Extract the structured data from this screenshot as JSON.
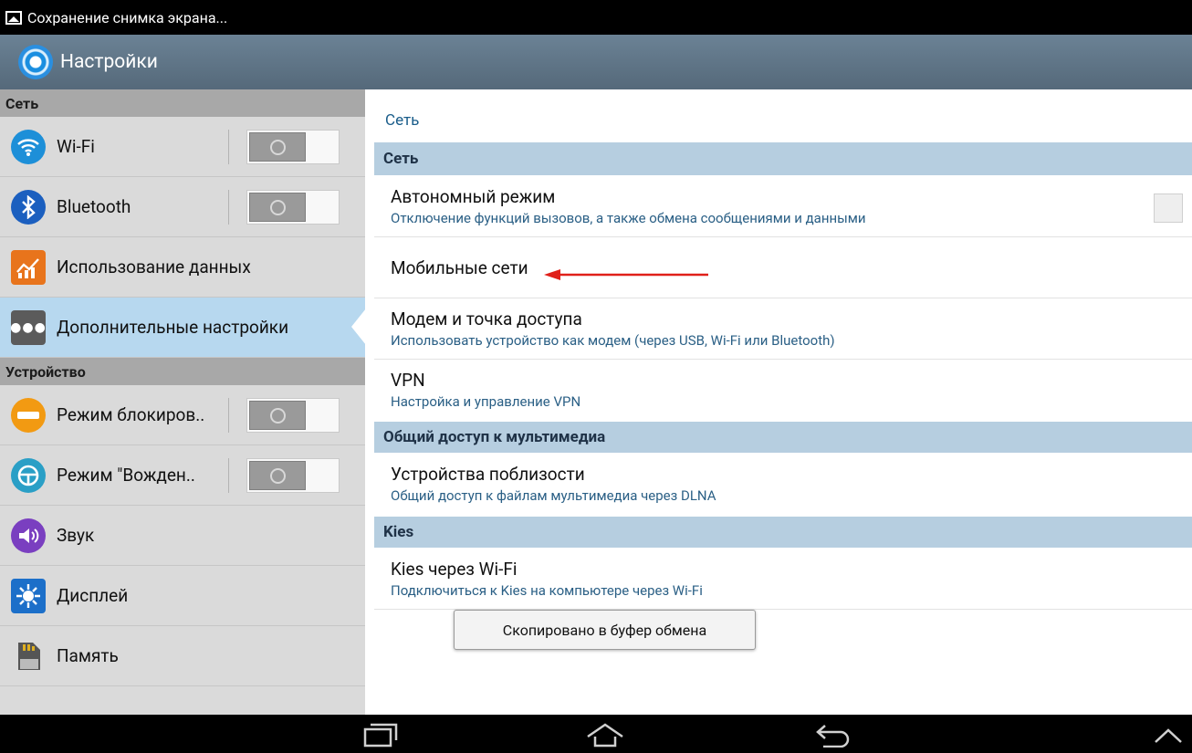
{
  "status_bar": {
    "notification": "Сохранение снимка экрана..."
  },
  "action_bar": {
    "title": "Настройки"
  },
  "left_pane": {
    "sections": [
      {
        "header": "Сеть"
      },
      {
        "header": "Устройство"
      }
    ],
    "items": [
      {
        "label": "Wi-Fi",
        "icon": "wifi-icon",
        "toggle": "off"
      },
      {
        "label": "Bluetooth",
        "icon": "bluetooth-icon",
        "toggle": "off"
      },
      {
        "label": "Использование данных",
        "icon": "data-usage-icon"
      },
      {
        "label": "Дополнительные настройки",
        "icon": "more-icon",
        "selected": true
      },
      {
        "label": "Режим блокиров..",
        "icon": "block-icon",
        "toggle": "off"
      },
      {
        "label": "Режим \"Вожден..",
        "icon": "driving-icon",
        "toggle": "off"
      },
      {
        "label": "Звук",
        "icon": "sound-icon"
      },
      {
        "label": "Дисплей",
        "icon": "display-icon"
      },
      {
        "label": "Память",
        "icon": "storage-icon"
      }
    ]
  },
  "right_pane": {
    "breadcrumb": "Сеть",
    "sections": [
      {
        "header": "Сеть"
      },
      {
        "header": "Общий доступ к мультимедиа"
      },
      {
        "header": "Kies"
      }
    ],
    "items": [
      {
        "title": "Автономный режим",
        "subtitle": "Отключение функций вызовов, а также обмена сообщениями и данными",
        "checkbox": "unchecked"
      },
      {
        "title": "Мобильные сети"
      },
      {
        "title": "Модем и точка доступа",
        "subtitle": "Использовать устройство как модем (через USB, Wi-Fi или Bluetooth)"
      },
      {
        "title": "VPN",
        "subtitle": "Настройка и управление VPN"
      },
      {
        "title": "Устройства поблизости",
        "subtitle": "Общий доступ к файлам мультимедиа через DLNA"
      },
      {
        "title": "Kies через Wi-Fi",
        "subtitle": "Подключиться к Kies на компьютере через Wi-Fi"
      }
    ]
  },
  "toast": "Скопировано в буфер обмена",
  "colors": {
    "accent_arrow": "#e0201a",
    "selection": "#b7d8ef",
    "section_header": "#b6cee0"
  },
  "nav_bar": {
    "buttons": [
      "recent-apps-icon",
      "home-icon",
      "back-icon",
      "up-chevron-icon"
    ]
  }
}
